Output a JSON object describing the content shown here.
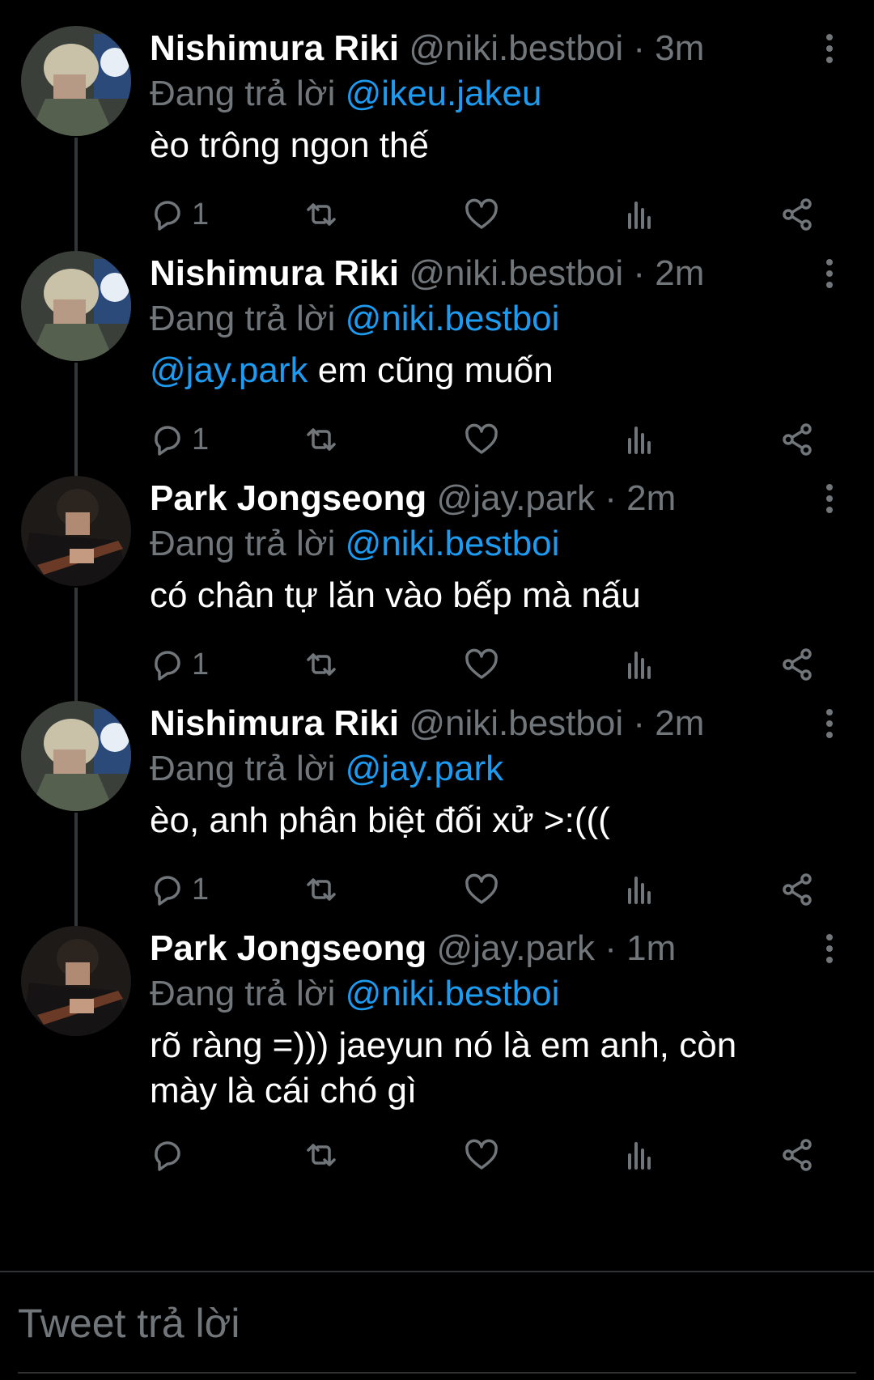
{
  "reply_prefix": "Đang trả lời",
  "tweets": [
    {
      "name": "Nishimura Riki",
      "handle": "@niki.bestboi",
      "sep": "·",
      "time": "3m",
      "reply_to": "@ikeu.jakeu",
      "mention": "",
      "text": "èo trông ngon thế",
      "text2": "",
      "reply_count": "1"
    },
    {
      "name": "Nishimura Riki",
      "handle": "@niki.bestboi",
      "sep": "·",
      "time": "2m",
      "reply_to": "@niki.bestboi",
      "mention": "@jay.park",
      "text": " em cũng muốn",
      "text2": "",
      "reply_count": "1"
    },
    {
      "name": "Park Jongseong",
      "handle": "@jay.park",
      "sep": "·",
      "time": "2m",
      "reply_to": "@niki.bestboi",
      "mention": "",
      "text": "có chân tự lăn vào bếp mà nấu",
      "text2": "",
      "reply_count": "1"
    },
    {
      "name": "Nishimura Riki",
      "handle": "@niki.bestboi",
      "sep": "·",
      "time": "2m",
      "reply_to": "@jay.park",
      "mention": "",
      "text": "èo, anh phân biệt đối xử >:(((",
      "text2": "",
      "reply_count": "1"
    },
    {
      "name": "Park Jongseong",
      "handle": "@jay.park",
      "sep": "·",
      "time": "1m",
      "reply_to": "@niki.bestboi",
      "mention": "",
      "text": "rõ ràng =))) jaeyun nó là em anh, còn",
      "text2": "mày là cái chó gì",
      "reply_count": ""
    }
  ],
  "compose": {
    "placeholder": "Tweet trả lời"
  },
  "icons": {
    "reply": "reply-icon",
    "retweet": "retweet-icon",
    "like": "heart-icon",
    "views": "views-icon",
    "share": "share-icon",
    "more": "more-vertical-icon"
  },
  "colors": {
    "background": "#000000",
    "text": "#ffffff",
    "muted": "#71767b",
    "link": "#1d9bf0"
  }
}
